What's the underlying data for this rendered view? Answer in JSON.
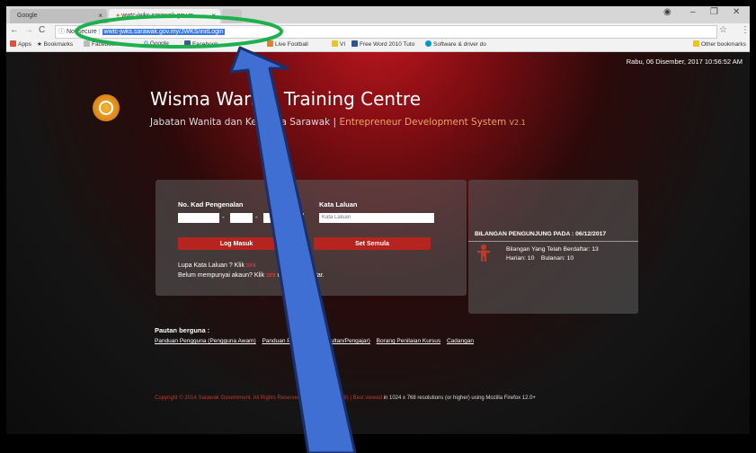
{
  "browser": {
    "tabs": [
      {
        "label": "Google"
      },
      {
        "label": "wwtc-jwks.sarawak.gov.m"
      }
    ],
    "address": {
      "security": "Not secure",
      "url": "wwtc-jwks.sarawak.gov.my/JWKS/initLogin"
    },
    "bookmarks": [
      {
        "label": "Apps",
        "icon": "apps-icon",
        "color": "#e74c3c"
      },
      {
        "label": "Bookmarks",
        "icon": "star-icon",
        "color": "#444"
      },
      {
        "label": "Facebook",
        "icon": "page-icon",
        "color": "#888"
      },
      {
        "label": "Google",
        "icon": "google-icon",
        "color": "#4285f4"
      },
      {
        "label": "Facebook",
        "icon": "facebook-icon",
        "color": "#3b5998"
      },
      {
        "label": "Live Football",
        "icon": "live-icon",
        "color": "#e67e22"
      },
      {
        "label": "VI",
        "icon": "folder-icon",
        "color": "#f1c40f"
      },
      {
        "label": "Free Word 2010 Tuto",
        "icon": "word-icon",
        "color": "#2b579a"
      },
      {
        "label": "Software & driver do",
        "icon": "hp-icon",
        "color": "#0096d6"
      }
    ],
    "other_bookmarks": "Other bookmarks"
  },
  "page": {
    "datetime": "Rabu, 06 Disember, 2017 10:56:52 AM",
    "title": "Wisma Wanita Training Centre",
    "subtitle_pre": "Jabatan Wanita dan Keluarga Sarawak | ",
    "subtitle_sys": "Entrepreneur Development System",
    "version": "V2.1",
    "login": {
      "ic_label": "No. Kad Pengenalan",
      "pw_label": "Kata Laluan",
      "pw_placeholder": "Kata Laluan",
      "login_btn": "Log Masuk",
      "reset_btn": "Set Semula",
      "forgot_text": "Lupa Kata Laluan ? Klik",
      "forgot_link": "sini",
      "register_text": "Belum mempunyai akaun? Klik",
      "register_link": "sini",
      "register_tail": "untuk mendaftar."
    },
    "visitor": {
      "heading": "BILANGAN PENGUNJUNG PADA : 06/12/2017",
      "registered": "Bilangan Yang Telah Berdaftar: 13",
      "daily": "Harian: 10",
      "monthly": "Bulanan: 10"
    },
    "pautan": {
      "heading": "Pautan berguna :",
      "links": [
        "Panduan Pengguna (Pengguna Awam)",
        "Panduan Pengguna (Konsultan/Pengajar)",
        "Borang Penilaian Kursus",
        "Cadangan"
      ]
    },
    "footer": {
      "copyright": "Copyright © 2014 Sarawak Government. All Rights Reserved. | v2.1 (24.09.2016) | Best viewed",
      "best": "in 1024 x 768 resolutions (or higher) using Mozilla Firefox 12.0+"
    }
  }
}
